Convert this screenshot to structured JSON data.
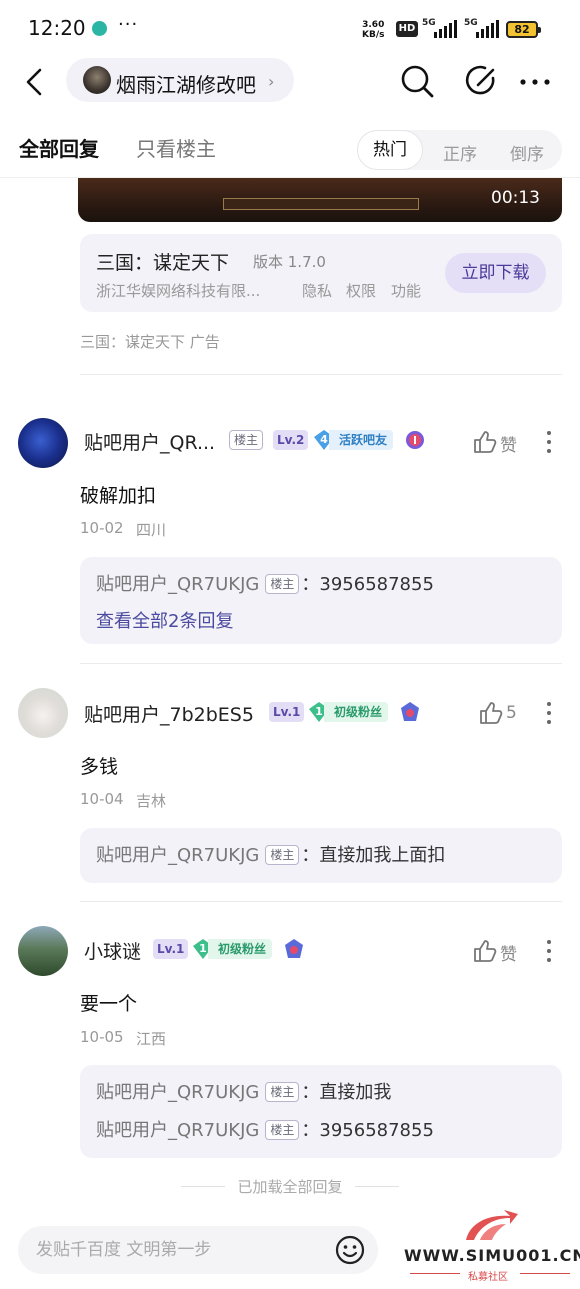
{
  "status_bar": {
    "time": "12:20",
    "more": "···",
    "speed_value": "3.60",
    "speed_unit": "KB/s",
    "hd_label": "HD",
    "sim1": "5G",
    "sim2": "5G",
    "battery": "82",
    "battery_color": "#f2c230"
  },
  "nav": {
    "forum_name": "烟雨江湖修改吧",
    "icons": [
      "back-arrow-icon",
      "search-icon",
      "edit-icon",
      "more-icon"
    ]
  },
  "tabs": {
    "all_replies": "全部回复",
    "host_only": "只看楼主",
    "sort": {
      "hot": "热门",
      "asc": "正序",
      "desc": "倒序",
      "selected": "热门"
    }
  },
  "ad": {
    "video_duration": "00:13",
    "app_title": "三国：谋定天下",
    "version": "版本 1.7.0",
    "company": "浙江华娱网络科技有限...",
    "privacy": "隐私",
    "permissions": "权限",
    "features": "功能",
    "download": "立即下载",
    "source": "三国：谋定天下  广告"
  },
  "comments": [
    {
      "user": "贴吧用户_QR...",
      "host_tag": "楼主",
      "level": "Lv.2",
      "fan_level": "4",
      "fan_title": "活跃吧友",
      "like": "赞",
      "text": "破解加扣",
      "date": "10-02",
      "location": "四川",
      "replies": [
        {
          "user": "贴吧用户_QR7UKJG",
          "tag": "楼主",
          "text": "3956587855"
        }
      ],
      "view_all": "查看全部2条回复"
    },
    {
      "user": "贴吧用户_7b2bES5",
      "level": "Lv.1",
      "fan_level": "1",
      "fan_title": "初级粉丝",
      "like": "5",
      "text": "多钱",
      "date": "10-04",
      "location": "吉林",
      "replies": [
        {
          "user": "贴吧用户_QR7UKJG",
          "tag": "楼主",
          "text": "直接加我上面扣"
        }
      ]
    },
    {
      "user": "小球谜",
      "level": "Lv.1",
      "fan_level": "1",
      "fan_title": "初级粉丝",
      "like": "赞",
      "text": "要一个",
      "date": "10-05",
      "location": "江西",
      "replies": [
        {
          "user": "贴吧用户_QR7UKJG",
          "tag": "楼主",
          "text": "直接加我"
        },
        {
          "user": "贴吧用户_QR7UKJG",
          "tag": "楼主",
          "text": "3956587855"
        }
      ]
    }
  ],
  "end_note": "已加载全部回复",
  "composer": {
    "placeholder": "发贴千百度 文明第一步"
  },
  "watermark": {
    "text": "WWW.SIMU001.CN",
    "sub": "私募社区"
  },
  "colors": {
    "accent": "#4a3a9a",
    "level_bg": "#e3ddf6",
    "fan_blue": "#4aa0e6",
    "fan_green": "#3cbf8a",
    "card_bg": "#f3f2f8"
  }
}
